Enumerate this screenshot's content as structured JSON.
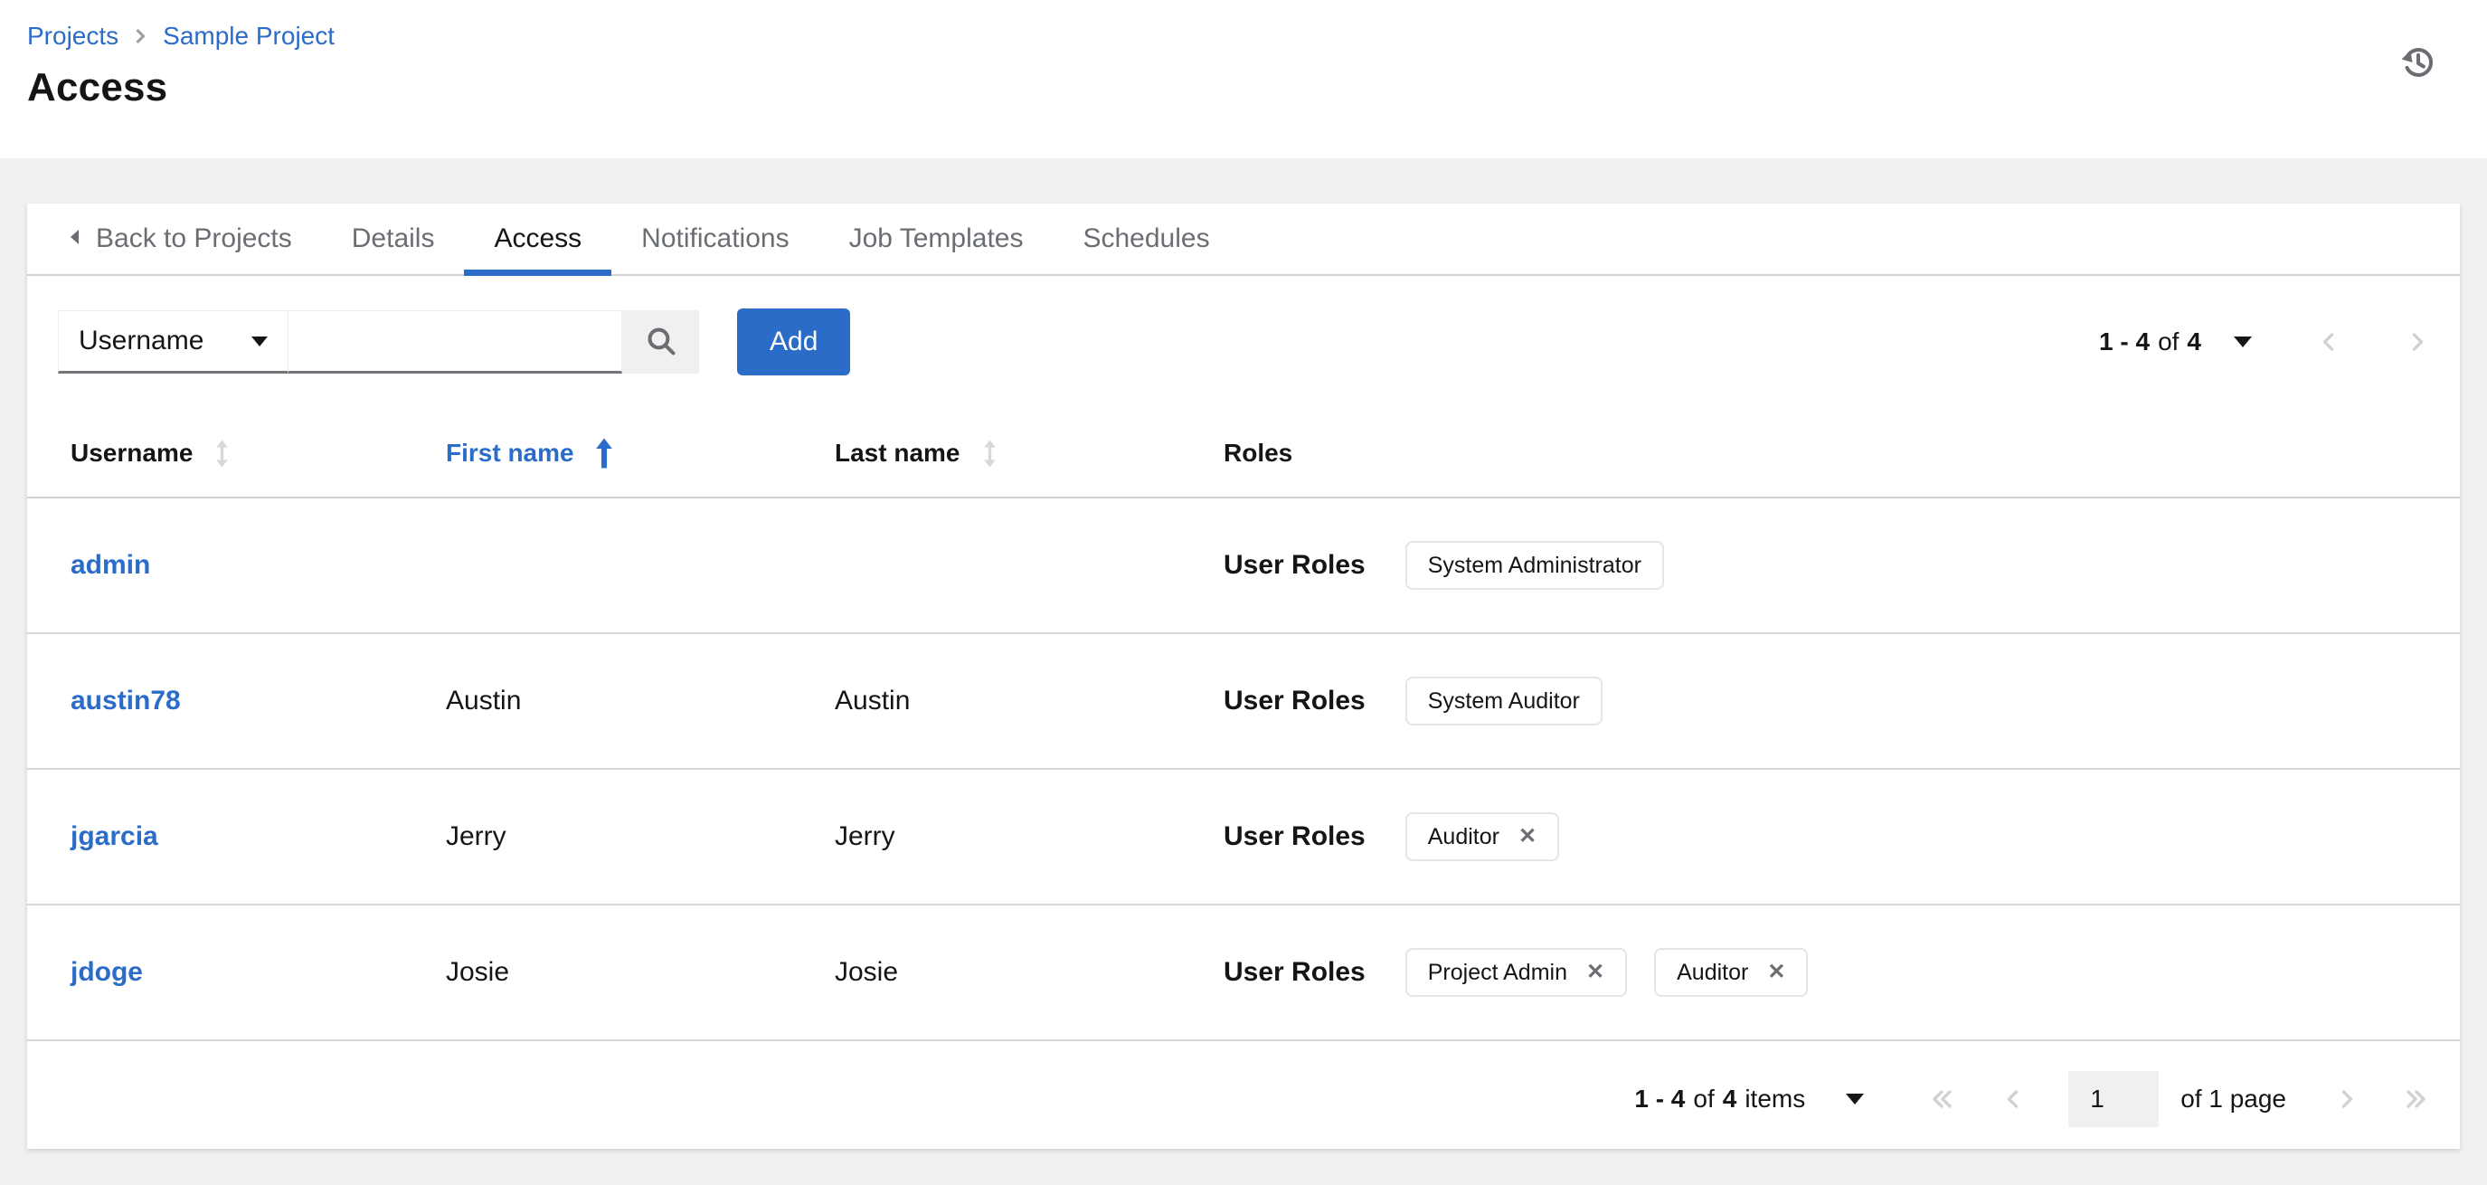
{
  "colors": {
    "accent": "#2b6cc8",
    "bg": "#f0f0f0",
    "border": "#d2d2d2",
    "gray": "#6a6e73",
    "dark": "#151515",
    "rowborder": "#d7d7d7"
  },
  "header": {
    "breadcrumb": {
      "items": [
        "Projects",
        "Sample Project"
      ]
    },
    "title": "Access"
  },
  "tabs": {
    "back_label": "Back to Projects",
    "items": [
      {
        "label": "Details",
        "active": false
      },
      {
        "label": "Access",
        "active": true
      },
      {
        "label": "Notifications",
        "active": false
      },
      {
        "label": "Job Templates",
        "active": false
      },
      {
        "label": "Schedules",
        "active": false
      }
    ]
  },
  "toolbar": {
    "filter_key": "Username",
    "search_value": "",
    "add_label": "Add",
    "pagination": {
      "range": "1 - 4",
      "of_word": "of",
      "total": "4"
    }
  },
  "table": {
    "roles_label": "User Roles",
    "close_glyph": "✕",
    "columns": [
      {
        "label": "Username",
        "sort": "sortable"
      },
      {
        "label": "First name",
        "sort": "asc"
      },
      {
        "label": "Last name",
        "sort": "sortable"
      },
      {
        "label": "Roles",
        "sort": "none"
      }
    ],
    "rows": [
      {
        "username": "admin",
        "first": "",
        "last": "",
        "roles": [
          {
            "name": "System Administrator",
            "removable": false
          }
        ]
      },
      {
        "username": "austin78",
        "first": "Austin",
        "last": "Austin",
        "roles": [
          {
            "name": "System Auditor",
            "removable": false
          }
        ]
      },
      {
        "username": "jgarcia",
        "first": "Jerry",
        "last": "Jerry",
        "roles": [
          {
            "name": "Auditor",
            "removable": true
          }
        ]
      },
      {
        "username": "jdoge",
        "first": "Josie",
        "last": "Josie",
        "roles": [
          {
            "name": "Project Admin",
            "removable": true
          },
          {
            "name": "Auditor",
            "removable": true
          }
        ]
      }
    ]
  },
  "footer": {
    "items_range": "1 - 4",
    "of_word": "of",
    "items_total": "4",
    "items_word": "items",
    "page_value": "1",
    "page_label": "of 1 page"
  }
}
